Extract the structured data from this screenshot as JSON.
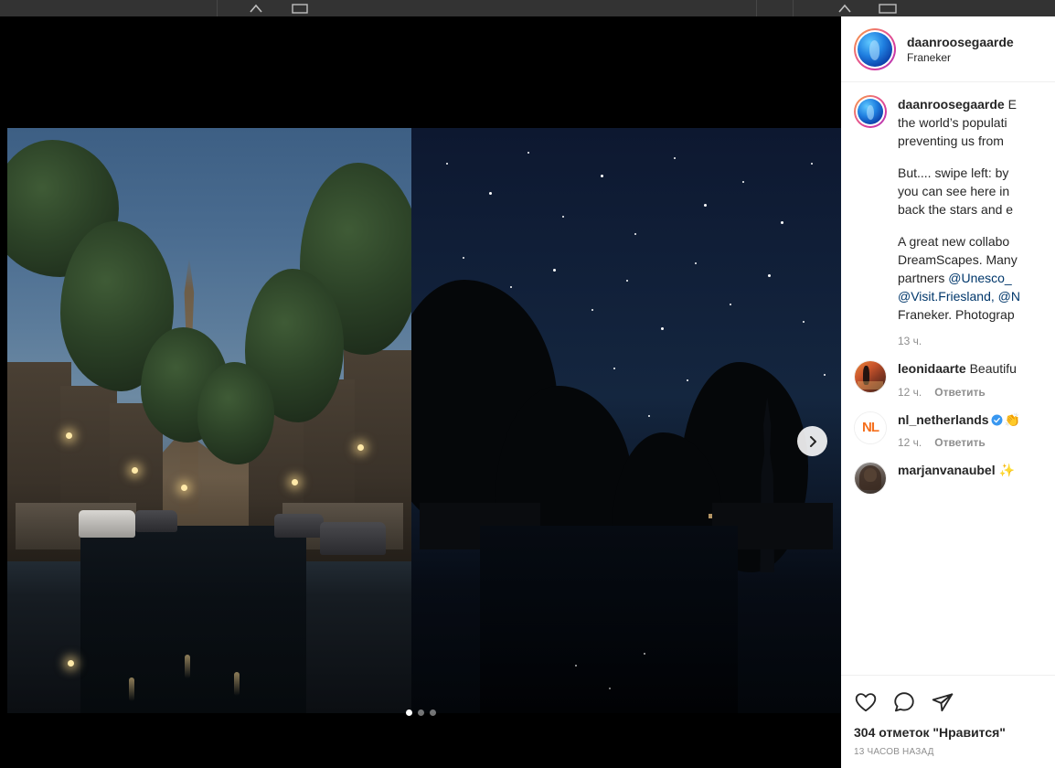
{
  "chrome": {
    "icons": [
      "chevron-up-icon",
      "window-icon"
    ]
  },
  "post": {
    "header": {
      "username": "daanroosegaarde",
      "separator": "•",
      "location": "Franeker",
      "avatar": "profile-avatar"
    },
    "caption": {
      "username": "daanroosegaarde",
      "paragraphs": [
        {
          "lead": "daanroosegaarde",
          "lines": [
            "E",
            "the world’s populati",
            "preventing us from "
          ]
        },
        {
          "lead": "",
          "lines": [
            "But.... swipe left: by ",
            "you can see here in ",
            "back the stars and e"
          ]
        },
        {
          "lead": "",
          "lines": [
            "A great new collabo",
            "DreamScapes. Many",
            "partners ",
            "@Visit.Friesland, @N",
            "Franeker. Photograp"
          ]
        }
      ],
      "mentions": [
        "@Unesco_",
        "@Visit.Friesland,",
        "@N"
      ],
      "time": "13 ч."
    },
    "comments": [
      {
        "avatar": "artwork-avatar",
        "username": "leonidaarte",
        "text": "Beautifu",
        "verified": false,
        "time": "12 ч.",
        "reply": "Ответить"
      },
      {
        "avatar": "nl-logo-avatar",
        "username": "nl_netherlands",
        "text": "👏",
        "verified": true,
        "time": "12 ч.",
        "reply": "Ответить"
      },
      {
        "avatar": "portrait-avatar",
        "username": "marjanvanaubel",
        "text": "✨",
        "verified": false,
        "time": "",
        "reply": ""
      }
    ],
    "actions": {
      "like": "heart-icon",
      "comment": "comment-icon",
      "share": "share-icon"
    },
    "likes": "304 отметок \"Нравится\"",
    "posted": "13 ЧАСОВ НАЗАД"
  },
  "media": {
    "slides": [
      {
        "name": "canal-dusk-photo",
        "alt": "Franeker canal at dusk with lit town hall tower"
      },
      {
        "name": "canal-starry-night-photo",
        "alt": "Same canal under a starry night sky"
      }
    ],
    "dots": [
      {
        "active": true
      },
      {
        "active": false
      },
      {
        "active": false
      }
    ],
    "next_label": "chevron-right-icon"
  },
  "colors": {
    "accent": "#00376b",
    "verified_blue": "#3897f0",
    "muted": "#8e8e8e",
    "text": "#262626",
    "panel_bg": "#ffffff",
    "media_bg": "#000000",
    "nl_orange": "#f5701e"
  }
}
